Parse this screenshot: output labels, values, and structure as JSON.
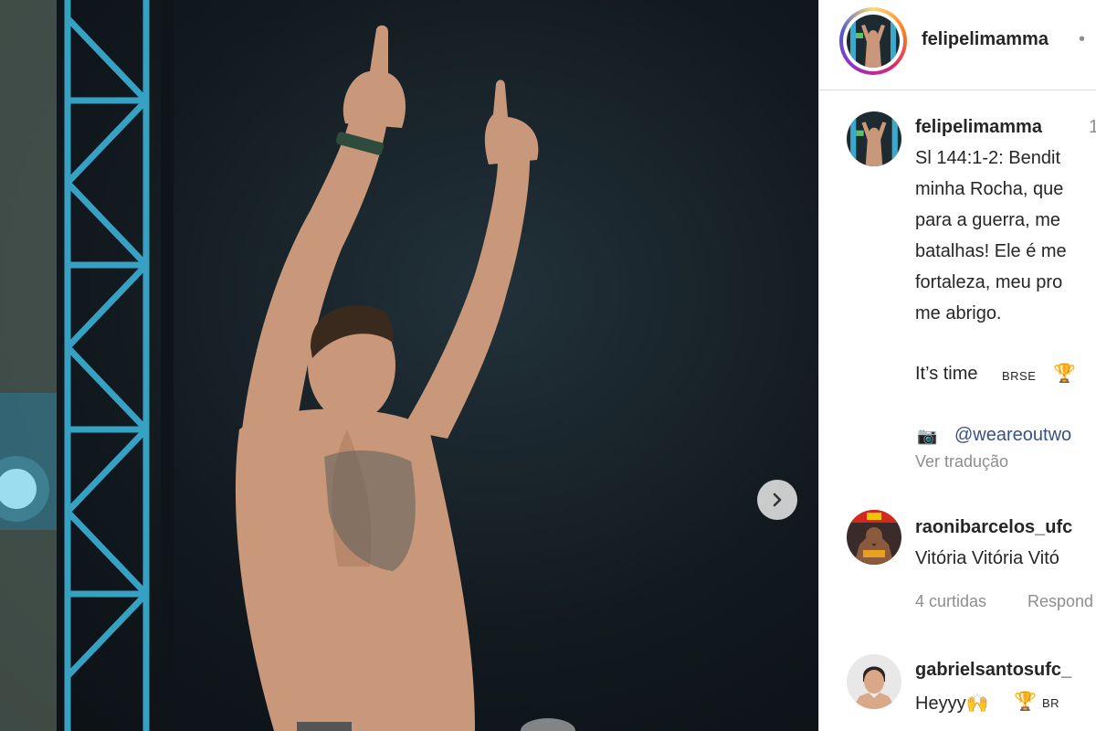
{
  "post": {
    "author": "felipelimamma",
    "header_dot": "•",
    "caption_author": "felipelimamma",
    "caption_time": "1",
    "caption_lines": [
      "Sl 144:1-2: Bendit",
      "minha Rocha, que",
      "para a guerra, me",
      "batalhas! Ele é me",
      "fortaleza, meu pro",
      "me abrigo."
    ],
    "its_time": "It’s time",
    "its_time_tag": "BRSE",
    "trophy": "🏆",
    "camera": "📷",
    "credit": "@weareoutwo",
    "translate": "Ver tradução"
  },
  "comments": [
    {
      "user": "raonibarcelos_ufc",
      "text": "Vitória Vitória Vitó",
      "likes": "4 curtidas",
      "reply": "Respond"
    },
    {
      "user": "gabrielsantosufc_",
      "text": "Heyyy🙌",
      "trophy": "🏆",
      "tag": "BR"
    }
  ],
  "icons": {
    "next": "chevron-right-icon",
    "avatar": "profile-avatar"
  },
  "colors": {
    "photo_bg": "#121a1f",
    "truss": "#3aa9cc",
    "skin": "#c9987a",
    "link": "#385185",
    "muted": "#8e8e8e"
  }
}
